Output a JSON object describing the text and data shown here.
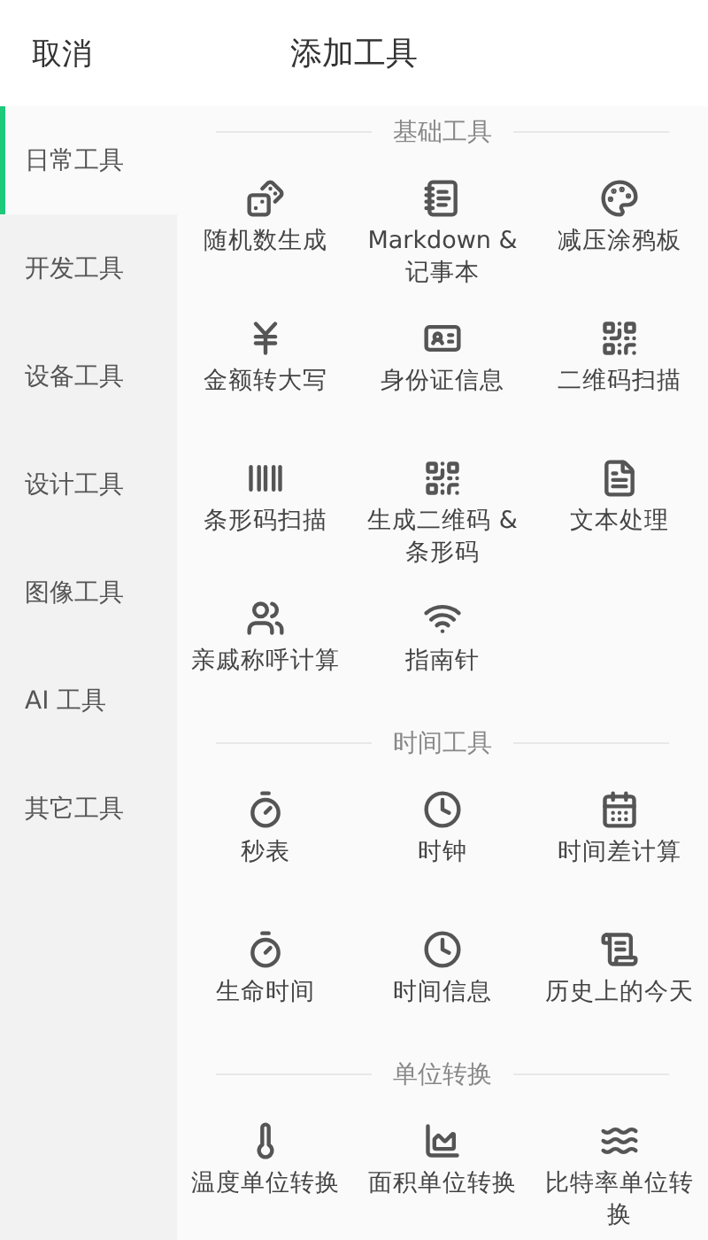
{
  "header": {
    "cancel": "取消",
    "title": "添加工具"
  },
  "sidebar": {
    "items": [
      {
        "label": "日常工具",
        "selected": true
      },
      {
        "label": "开发工具",
        "selected": false
      },
      {
        "label": "设备工具",
        "selected": false
      },
      {
        "label": "设计工具",
        "selected": false
      },
      {
        "label": "图像工具",
        "selected": false
      },
      {
        "label": "AI 工具",
        "selected": false
      },
      {
        "label": "其它工具",
        "selected": false
      }
    ]
  },
  "sections": [
    {
      "title": "基础工具",
      "tools": [
        {
          "label": "随机数生成"
        },
        {
          "label": "Markdown & 记事本"
        },
        {
          "label": "减压涂鸦板"
        },
        {
          "label": "金额转大写"
        },
        {
          "label": "身份证信息"
        },
        {
          "label": "二维码扫描"
        },
        {
          "label": "条形码扫描"
        },
        {
          "label": "生成二维码 & 条形码"
        },
        {
          "label": "文本处理"
        },
        {
          "label": "亲戚称呼计算"
        },
        {
          "label": "指南针"
        }
      ]
    },
    {
      "title": "时间工具",
      "tools": [
        {
          "label": "秒表"
        },
        {
          "label": "时钟"
        },
        {
          "label": "时间差计算"
        },
        {
          "label": "生命时间"
        },
        {
          "label": "时间信息"
        },
        {
          "label": "历史上的今天"
        }
      ]
    },
    {
      "title": "单位转换",
      "tools": [
        {
          "label": "温度单位转换"
        },
        {
          "label": "面积单位转换"
        },
        {
          "label": "比特率单位转换"
        }
      ]
    }
  ]
}
